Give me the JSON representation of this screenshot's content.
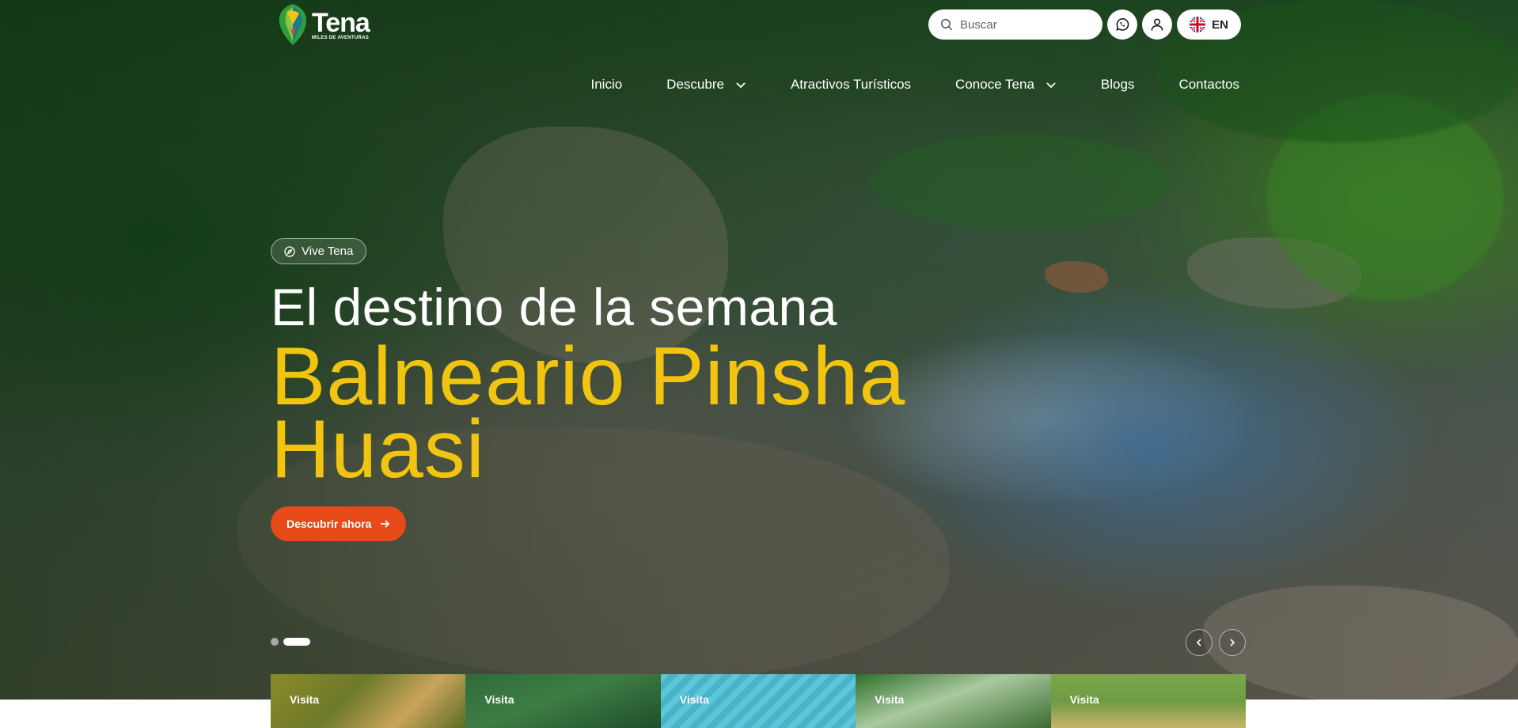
{
  "brand": {
    "name": "Tena",
    "tagline": "MILES DE AVENTURAS"
  },
  "search": {
    "placeholder": "Buscar"
  },
  "language": {
    "code": "EN"
  },
  "nav": {
    "items": [
      {
        "label": "Inicio"
      },
      {
        "label": "Descubre",
        "has_dropdown": true
      },
      {
        "label": "Atractivos Turísticos"
      },
      {
        "label": "Conoce Tena",
        "has_dropdown": true
      },
      {
        "label": "Blogs"
      },
      {
        "label": "Contactos"
      }
    ]
  },
  "hero": {
    "badge": "Vive Tena",
    "headline": "El destino de la semana",
    "destination_line1": "Balneario Pinsha",
    "destination_line2": "Huasi",
    "cta": "Descubrir ahora",
    "slides_total": 2,
    "active_slide": 2
  },
  "cards": [
    {
      "label": "Visita"
    },
    {
      "label": "Visita"
    },
    {
      "label": "Visita"
    },
    {
      "label": "Visita"
    },
    {
      "label": "Visita"
    }
  ],
  "colors": {
    "accent_yellow": "#f1c40f",
    "cta_orange": "#e64a19",
    "text_white": "#ffffff"
  },
  "icons": [
    "search-icon",
    "whatsapp-icon",
    "user-icon",
    "uk-flag-icon",
    "chevron-down-icon",
    "compass-icon",
    "arrow-right-icon",
    "chevron-left-icon",
    "chevron-right-icon"
  ]
}
